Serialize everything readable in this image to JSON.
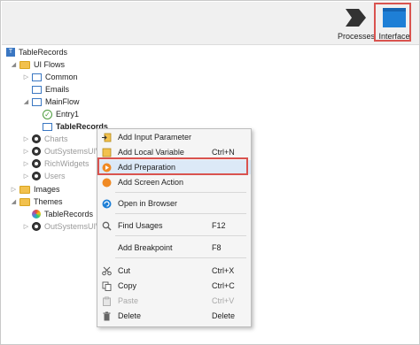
{
  "toolbar": {
    "processes_label": "Processes",
    "interface_label": "Interface"
  },
  "tree": {
    "root": "TableRecords",
    "ui_flows": "UI Flows",
    "common": "Common",
    "emails": "Emails",
    "mainflow": "MainFlow",
    "entry": "Entry1",
    "tablerecords_screen": "TableRecords",
    "charts": "Charts",
    "outsystems_uiw_1": "OutSystemsUIW",
    "richwidgets": "RichWidgets",
    "users": "Users",
    "images": "Images",
    "themes": "Themes",
    "theme_tablerecords": "TableRecords",
    "outsystems_uiw_2": "OutSystemsUIW"
  },
  "menu": {
    "add_input_parameter": "Add Input Parameter",
    "add_local_variable": "Add Local Variable",
    "add_local_variable_shortcut": "Ctrl+N",
    "add_preparation": "Add Preparation",
    "add_screen_action": "Add Screen Action",
    "open_in_browser": "Open in Browser",
    "find_usages": "Find Usages",
    "find_usages_shortcut": "F12",
    "add_breakpoint": "Add Breakpoint",
    "add_breakpoint_shortcut": "F8",
    "cut": "Cut",
    "cut_shortcut": "Ctrl+X",
    "copy": "Copy",
    "copy_shortcut": "Ctrl+C",
    "paste": "Paste",
    "paste_shortcut": "Ctrl+V",
    "delete": "Delete",
    "delete_shortcut": "Delete"
  },
  "colors": {
    "highlight_border": "#d9534f",
    "selection_bg": "#dce9f7",
    "toolbar_bg": "#f0f0f0"
  }
}
